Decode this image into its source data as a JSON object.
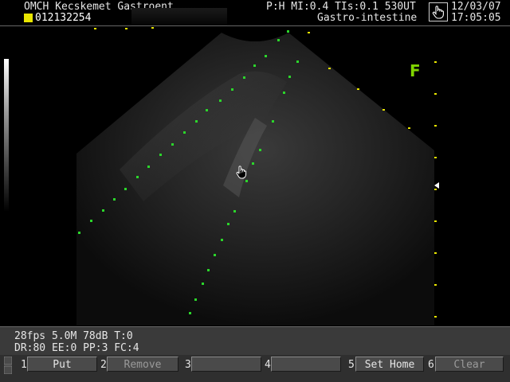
{
  "header": {
    "hospital": "OMCH Kecskemet Gastroent",
    "patient_id": "012132254",
    "params": "P:H MI:0.4 TIs:0.1 530UT",
    "exam": "Gastro-intestine",
    "date": "12/03/07",
    "time": "17:05:05"
  },
  "image": {
    "orientation_marker": "F",
    "accent_color": "#7fd400",
    "marker_color": "#2bd62b"
  },
  "status": {
    "line1": "28fps  5.0M  78dB  T:0",
    "line2": "DR:80 EE:0 PP:3 FC:4"
  },
  "softkeys": [
    {
      "num": "1",
      "label": "Put",
      "dim": false
    },
    {
      "num": "2",
      "label": "Remove",
      "dim": true
    },
    {
      "num": "3",
      "label": "",
      "dim": true
    },
    {
      "num": "4",
      "label": "",
      "dim": true
    },
    {
      "num": "5",
      "label": "Set Home",
      "dim": false
    },
    {
      "num": "6",
      "label": "Clear",
      "dim": true
    }
  ],
  "icons": {
    "header_hand": "hand-pointer-icon",
    "cursor": "hand-cursor-icon",
    "menu_arrows": "up-down-arrows-icon"
  }
}
